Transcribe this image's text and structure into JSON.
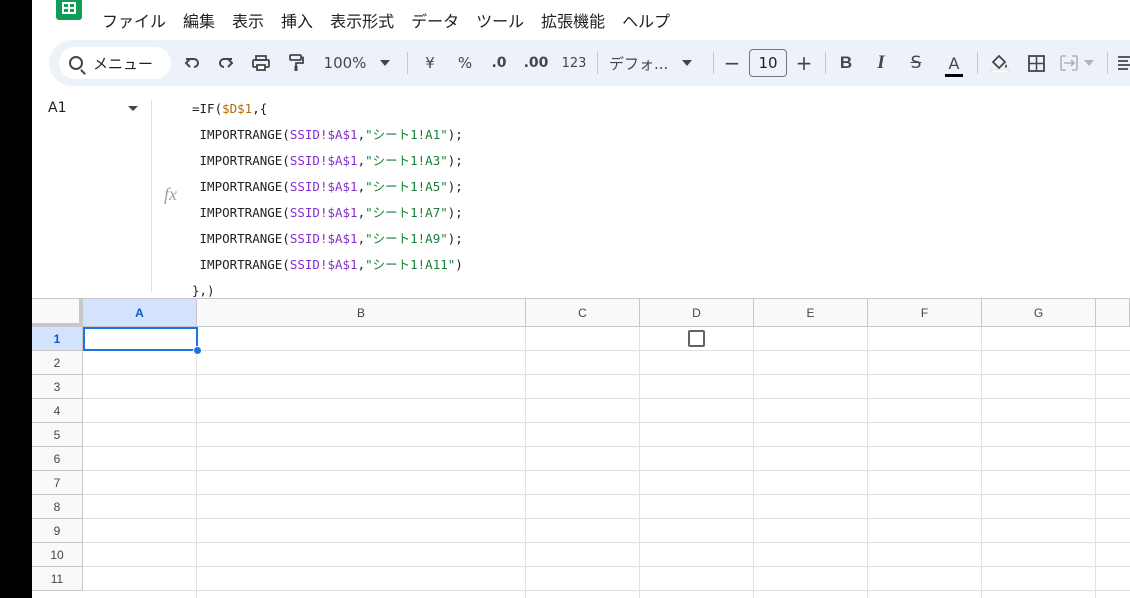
{
  "menu": [
    "ファイル",
    "編集",
    "表示",
    "挿入",
    "表示形式",
    "データ",
    "ツール",
    "拡張機能",
    "ヘルプ"
  ],
  "toolbar": {
    "search_label": "メニュー",
    "zoom": "100%",
    "currency": "¥",
    "percent": "%",
    "decrease_decimal": ".0",
    "increase_decimal": ".00",
    "number_format": "123",
    "font": "デフォ...",
    "font_size": "10",
    "minus": "−",
    "plus": "+",
    "bold": "B",
    "italic": "I",
    "strike": "S",
    "text_color": "A"
  },
  "namebox": "A1",
  "fx": "fx",
  "formula_lines": [
    [
      [
        "fn",
        "=IF("
      ],
      [
        "ref1",
        "$D$1"
      ],
      [
        "fn",
        ",{"
      ]
    ],
    [
      [
        "fn",
        " IMPORTRANGE("
      ],
      [
        "ref2",
        "SSID!$A$1"
      ],
      [
        "fn",
        ","
      ],
      [
        "str",
        "\"シート1!A1\""
      ],
      [
        "fn",
        ");"
      ]
    ],
    [
      [
        "fn",
        " IMPORTRANGE("
      ],
      [
        "ref2",
        "SSID!$A$1"
      ],
      [
        "fn",
        ","
      ],
      [
        "str",
        "\"シート1!A3\""
      ],
      [
        "fn",
        ");"
      ]
    ],
    [
      [
        "fn",
        " IMPORTRANGE("
      ],
      [
        "ref2",
        "SSID!$A$1"
      ],
      [
        "fn",
        ","
      ],
      [
        "str",
        "\"シート1!A5\""
      ],
      [
        "fn",
        ");"
      ]
    ],
    [
      [
        "fn",
        " IMPORTRANGE("
      ],
      [
        "ref2",
        "SSID!$A$1"
      ],
      [
        "fn",
        ","
      ],
      [
        "str",
        "\"シート1!A7\""
      ],
      [
        "fn",
        ");"
      ]
    ],
    [
      [
        "fn",
        " IMPORTRANGE("
      ],
      [
        "ref2",
        "SSID!$A$1"
      ],
      [
        "fn",
        ","
      ],
      [
        "str",
        "\"シート1!A9\""
      ],
      [
        "fn",
        ");"
      ]
    ],
    [
      [
        "fn",
        " IMPORTRANGE("
      ],
      [
        "ref2",
        "SSID!$A$1"
      ],
      [
        "fn",
        ","
      ],
      [
        "str",
        "\"シート1!A11\""
      ],
      [
        "fn",
        ")"
      ]
    ],
    [
      [
        "fn",
        "},)"
      ]
    ]
  ],
  "columns": [
    "A",
    "B",
    "C",
    "D",
    "E",
    "F",
    "G"
  ],
  "rows": [
    "1",
    "2",
    "3",
    "4",
    "5",
    "6",
    "7",
    "8",
    "9",
    "10",
    "11"
  ],
  "selected_cell": "A1",
  "colors": {
    "accent": "#1a73e8",
    "header_selected": "#d3e3fd",
    "logo": "#0f9d58"
  }
}
